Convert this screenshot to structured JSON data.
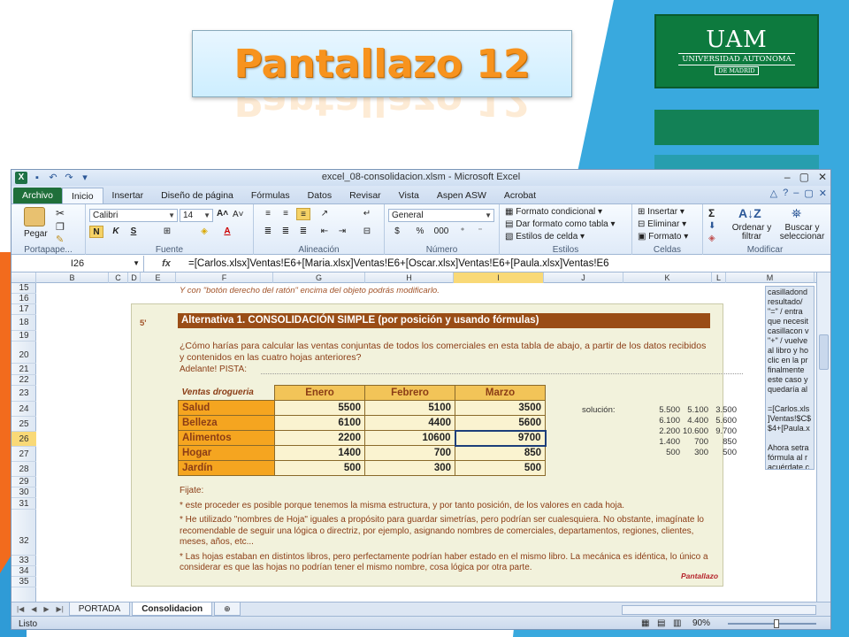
{
  "slide": {
    "title": "Pantallazo 12",
    "logo": {
      "mark": "UAM",
      "university": "UNIVERSIDAD AUTONOMA",
      "city": "DE MADRID",
      "color": "#0d7a3e"
    }
  },
  "window": {
    "title": "excel_08-consolidacion.xlsm  -  Microsoft Excel",
    "buttons": [
      "–",
      "▢",
      "✕"
    ]
  },
  "ribbon_tabs": [
    "Archivo",
    "Inicio",
    "Insertar",
    "Diseño de página",
    "Fórmulas",
    "Datos",
    "Revisar",
    "Vista",
    "Aspen ASW",
    "Acrobat"
  ],
  "active_tab": "Inicio",
  "ribbon": {
    "clipboard": {
      "paste": "Pegar",
      "label": "Portapape..."
    },
    "font": {
      "name": "Calibri",
      "size": "14",
      "bold": "N",
      "italic": "K",
      "underline": "S",
      "label": "Fuente"
    },
    "alignment": {
      "label": "Alineación"
    },
    "number": {
      "format": "General",
      "percent": "%",
      "thousands": "000",
      "label": "Número"
    },
    "styles": {
      "conditional": "Formato condicional",
      "table": "Dar formato como tabla",
      "cell_styles": "Estilos de celda",
      "label": "Estilos"
    },
    "cells": {
      "insert": "Insertar",
      "delete": "Eliminar",
      "format": "Formato",
      "label": "Celdas"
    },
    "editing": {
      "sigma": "Σ",
      "sort": "Ordenar y filtrar",
      "find": "Buscar y seleccionar",
      "label": "Modificar"
    }
  },
  "formula_bar": {
    "name_box": "I26",
    "fx": "fx",
    "formula": "=[Carlos.xlsx]Ventas!E6+[Maria.xlsx]Ventas!E6+[Oscar.xlsx]Ventas!E6+[Paula.xlsx]Ventas!E6"
  },
  "columns": [
    "B",
    "C",
    "D",
    "E",
    "F",
    "G",
    "H",
    "I",
    "J",
    "K",
    "L",
    "M"
  ],
  "selected_column": "I",
  "rows": [
    "15",
    "16",
    "17",
    "18",
    "19",
    "20",
    "21",
    "22",
    "23",
    "24",
    "25",
    "26",
    "27",
    "28",
    "29",
    "30",
    "31",
    "32",
    "33",
    "34",
    "35"
  ],
  "selected_row": "26",
  "sheet": {
    "note_top": "Y con \"botón derecho del ratón\" encima del objeto podrás modificarlo.",
    "step": "5'",
    "alt_title": "Alternativa 1. CONSOLIDACIÓN SIMPLE (por posición y usando fórmulas)",
    "question": "¿Cómo harías para calcular las ventas conjuntas de todos los comerciales en esta tabla de abajo, a partir de los datos recibidos y contenidos en las cuatro hojas anteriores?",
    "adelante": "Adelante!   PISTA:",
    "table": {
      "corner_label": "Ventas drogueria",
      "months": [
        "Enero",
        "Febrero",
        "Marzo"
      ],
      "rows": [
        {
          "label": "Salud",
          "values": [
            "5500",
            "5100",
            "3500"
          ]
        },
        {
          "label": "Belleza",
          "values": [
            "6100",
            "4400",
            "5600"
          ]
        },
        {
          "label": "Alimentos",
          "values": [
            "2200",
            "10600",
            "9700"
          ]
        },
        {
          "label": "Hogar",
          "values": [
            "1400",
            "700",
            "850"
          ]
        },
        {
          "label": "Jardín",
          "values": [
            "500",
            "300",
            "500"
          ]
        }
      ]
    },
    "solution_label": "solución:",
    "solution": [
      [
        "5.500",
        "5.100",
        "3.500"
      ],
      [
        "6.100",
        "4.400",
        "5.600"
      ],
      [
        "2.200",
        "10.600",
        "9.700"
      ],
      [
        "1.400",
        "700",
        "850"
      ],
      [
        "500",
        "300",
        "500"
      ]
    ],
    "notes": [
      "Fijate:",
      "* este proceder es posible porque tenemos la misma estructura, y por tanto posición, de los valores en cada hoja.",
      "* He utilizado \"nombres de Hoja\" iguales a propósito para guardar simetrías, pero podrían ser cualesquiera. No obstante, imagínate lo recomendable de seguir una lógica o directriz, por ejemplo, asignando nombres de comerciales, departamentos, regiones, clientes, meses, años, etc...",
      "* Las hojas estaban en distintos libros, pero perfectamente podrían haber estado en el mismo libro. La mecánica es idéntica, lo único a considerar es que las hojas no podrían tener el mismo nombre, cosa lógica por otra parte."
    ],
    "tag": "Pantallazo",
    "side_comment": [
      "casilladond",
      "resultado/",
      "\"=\" / entra",
      "que necesit",
      "casillacon v",
      "\"+\" / vuelve",
      "al libro y ho",
      "clic en la pr",
      "finalmente",
      "este caso y",
      "quedaría al",
      "",
      "=[Carlos.xls",
      "]Ventas!$C$",
      "$4+[Paula.x",
      "",
      "Ahora setra",
      "fórmula al r",
      "acuérdate c"
    ]
  },
  "sheet_tabs": [
    "PORTADA",
    "Consolidacion"
  ],
  "active_sheet": "Consolidacion",
  "status": {
    "ready": "Listo",
    "zoom": "90%"
  }
}
